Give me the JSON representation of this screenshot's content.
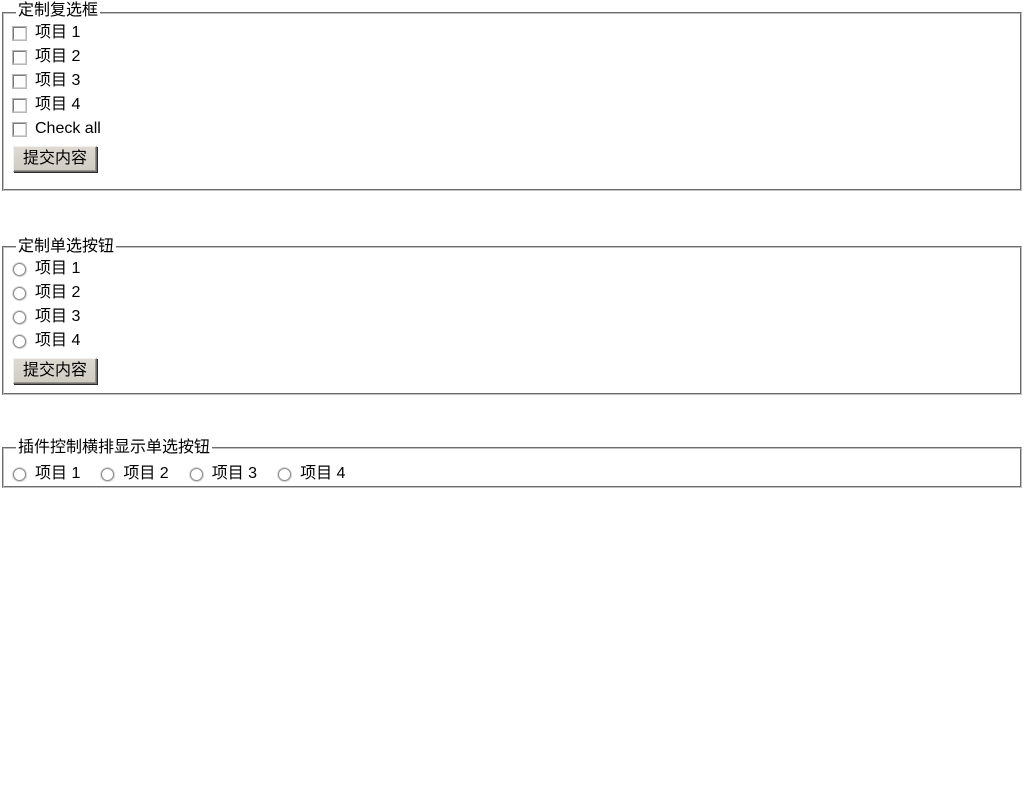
{
  "page": {
    "background": "#ffffff",
    "text_color": "#000000",
    "border_color": "#c0c0c0"
  },
  "sections": [
    {
      "id": "checkbox-group",
      "legend": "定制复选框",
      "control_type": "checkbox",
      "layout": "vertical",
      "options": [
        {
          "label": "项目 1",
          "checked": false
        },
        {
          "label": "项目 2",
          "checked": false
        },
        {
          "label": "项目 3",
          "checked": false
        },
        {
          "label": "项目 4",
          "checked": false
        },
        {
          "label": "Check all",
          "checked": false
        }
      ],
      "submit_label": "提交内容"
    },
    {
      "id": "radio-group",
      "legend": "定制单选按钮",
      "control_type": "radio",
      "layout": "vertical",
      "options": [
        {
          "label": "项目 1",
          "checked": false
        },
        {
          "label": "项目 2",
          "checked": false
        },
        {
          "label": "项目 3",
          "checked": false
        },
        {
          "label": "项目 4",
          "checked": false
        }
      ],
      "submit_label": "提交内容"
    },
    {
      "id": "inline-radio-group",
      "legend": "插件控制横排显示单选按钮",
      "control_type": "radio",
      "layout": "horizontal",
      "options": [
        {
          "label": "项目 1",
          "checked": false
        },
        {
          "label": "项目 2",
          "checked": false
        },
        {
          "label": "项目 3",
          "checked": false
        },
        {
          "label": "项目 4",
          "checked": false
        }
      ],
      "submit_label": null
    }
  ],
  "icons": {
    "checkbox_unchecked": "checkbox-unchecked-icon",
    "radio_unchecked": "radio-unchecked-icon"
  }
}
